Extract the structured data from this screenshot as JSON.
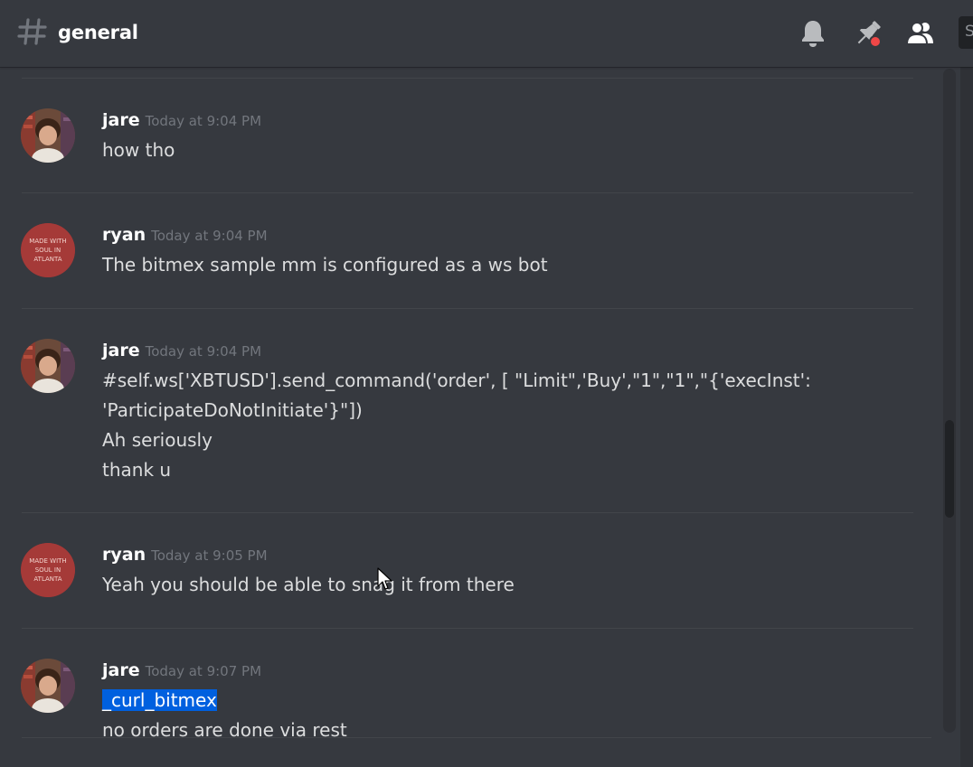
{
  "header": {
    "channel_name": "general",
    "search_fragment": "S"
  },
  "messages": [
    {
      "author": "jare",
      "timestamp": "Today at 9:04 PM",
      "lines": [
        "how tho"
      ]
    },
    {
      "author": "ryan",
      "timestamp": "Today at 9:04 PM",
      "lines": [
        "The bitmex sample mm is configured as a ws bot"
      ]
    },
    {
      "author": "jare",
      "timestamp": "Today at 9:04 PM",
      "lines": [
        "#self.ws['XBTUSD'].send_command('order', [ \"Limit\",'Buy',\"1\",\"1\",\"{'execInst':",
        "'ParticipateDoNotInitiate'}\"])",
        "Ah seriously",
        "thank u"
      ]
    },
    {
      "author": "ryan",
      "timestamp": "Today at 9:05 PM",
      "lines": [
        "Yeah you should be able to snag it from there"
      ]
    },
    {
      "author": "jare",
      "timestamp": "Today at 9:07 PM",
      "lines": [
        "_curl_bitmex",
        "no orders are done via rest"
      ]
    }
  ],
  "avatar_text": {
    "ryan": [
      "MADE WITH",
      "SOUL IN",
      "ATLANTA"
    ]
  },
  "colors": {
    "background": "#36393f",
    "header_text": "#ffffff",
    "message_text": "#dcddde",
    "timestamp": "#72767d",
    "selection": "#0060df",
    "pin_dot": "#f04747"
  },
  "icons": {
    "channel": "hash-icon",
    "notifications": "bell-icon",
    "pinned": "pin-icon",
    "members": "members-icon"
  }
}
